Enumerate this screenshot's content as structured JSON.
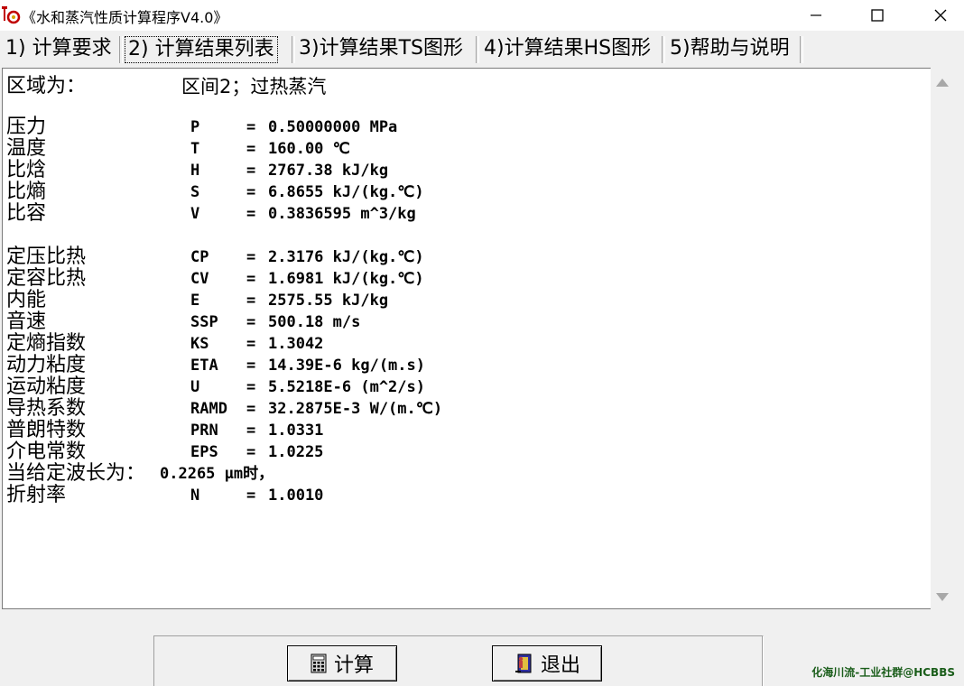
{
  "window": {
    "title": "《水和蒸汽性质计算程序V4.0》",
    "icon": "app-logo-icon"
  },
  "tabs": [
    {
      "label": "1) 计算要求"
    },
    {
      "label": "2) 计算结果列表",
      "active": true
    },
    {
      "label": "3)计算结果TS图形"
    },
    {
      "label": "4)计算结果HS图形"
    },
    {
      "label": "5)帮助与说明"
    }
  ],
  "results": {
    "region_label": "区域为：",
    "region_value": "区间2；过热蒸汽",
    "rows_a": [
      {
        "label": "压力",
        "symbol": "P",
        "eq": "=",
        "value": "0.50000000 MPa"
      },
      {
        "label": "温度",
        "symbol": "T",
        "eq": "=",
        "value": "160.00 ℃"
      },
      {
        "label": "比焓",
        "symbol": "H",
        "eq": "=",
        "value": "2767.38 kJ/kg"
      },
      {
        "label": "比熵",
        "symbol": "S",
        "eq": "=",
        "value": "6.8655 kJ/(kg.℃)"
      },
      {
        "label": "比容",
        "symbol": "V",
        "eq": "=",
        "value": "0.3836595 m^3/kg"
      }
    ],
    "rows_b": [
      {
        "label": "定压比热",
        "symbol": "CP",
        "eq": "=",
        "value": "2.3176 kJ/(kg.℃)"
      },
      {
        "label": "定容比热",
        "symbol": "CV",
        "eq": "=",
        "value": "1.6981 kJ/(kg.℃)"
      },
      {
        "label": "内能",
        "symbol": "E",
        "eq": "=",
        "value": "2575.55 kJ/kg"
      },
      {
        "label": "音速",
        "symbol": "SSP",
        "eq": "=",
        "value": "500.18 m/s"
      },
      {
        "label": "定熵指数",
        "symbol": "KS",
        "eq": "=",
        "value": "1.3042"
      },
      {
        "label": "动力粘度",
        "symbol": "ETA",
        "eq": "=",
        "value": "14.39E-6 kg/(m.s)"
      },
      {
        "label": "运动粘度",
        "symbol": "U",
        "eq": "=",
        "value": "5.5218E-6 (m^2/s)"
      },
      {
        "label": "导热系数",
        "symbol": "RAMD",
        "eq": "=",
        "value": "32.2875E-3 W/(m.℃)"
      },
      {
        "label": "普朗特数",
        "symbol": "PRN",
        "eq": "=",
        "value": "1.0331"
      },
      {
        "label": "介电常数",
        "symbol": "EPS",
        "eq": "=",
        "value": "1.0225"
      }
    ],
    "wavelength_label": "当给定波长为：",
    "wavelength_value": "0.2265 μm时，",
    "refraction": {
      "label": "折射率",
      "symbol": "N",
      "eq": "=",
      "value": "1.0010"
    }
  },
  "buttons": {
    "calc_label": "计算",
    "exit_label": "退出"
  },
  "watermark": "化海川流-工业社群@HCBBS"
}
